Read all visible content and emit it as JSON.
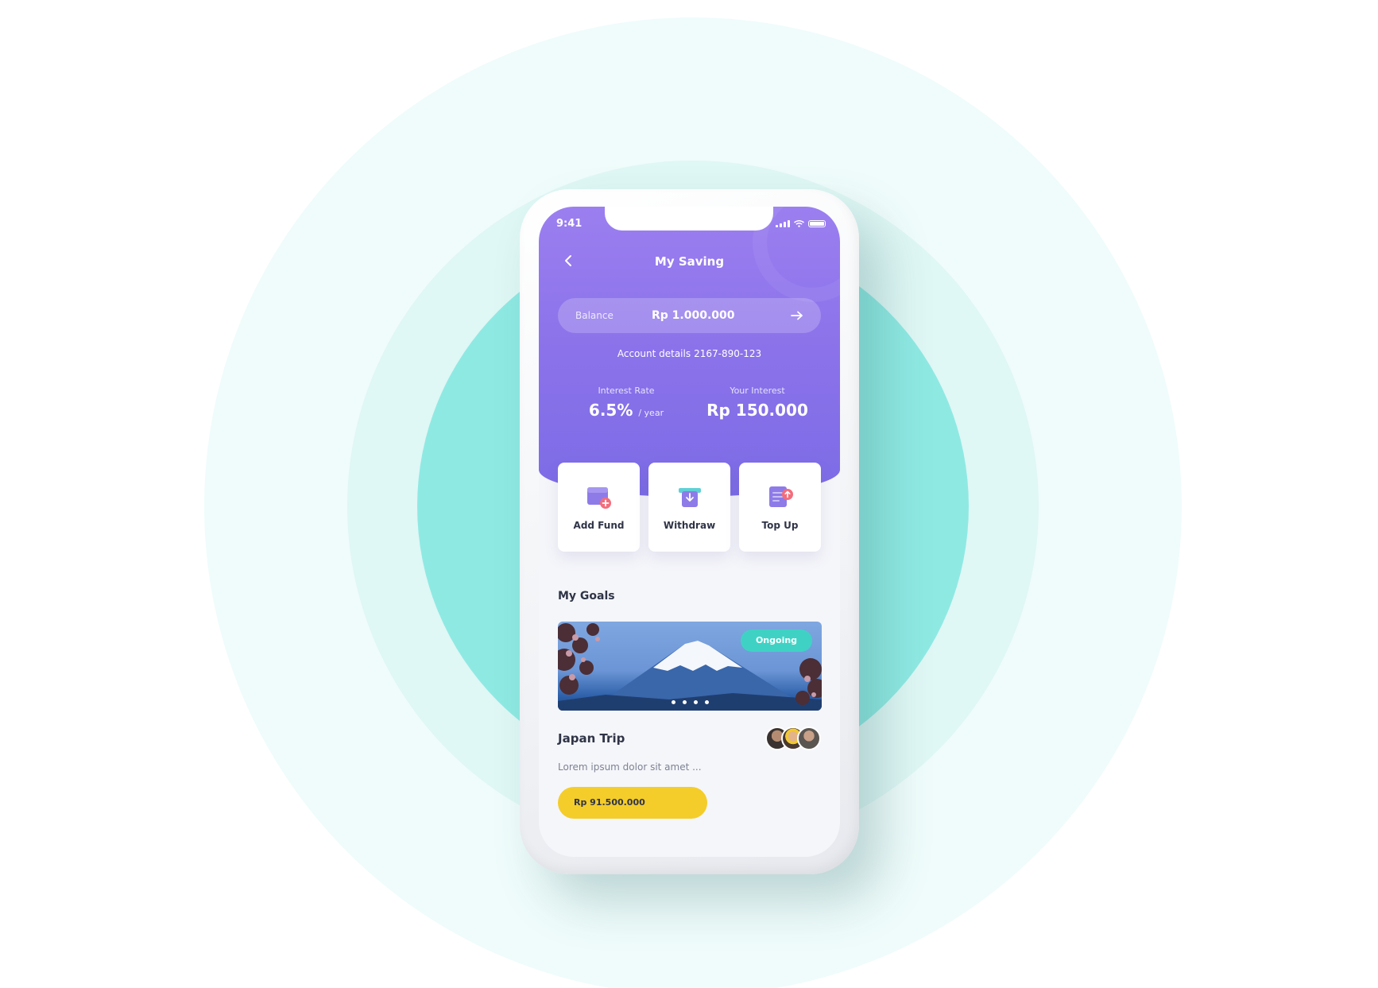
{
  "status_bar": {
    "time": "9:41"
  },
  "header": {
    "title": "My Saving",
    "balance": {
      "label": "Balance",
      "value": "Rp 1.000.000"
    },
    "account": {
      "label": "Account details",
      "number": "2167-890-123"
    },
    "interest_rate": {
      "label": "Interest Rate",
      "value": "6.5%",
      "unit": "/ year"
    },
    "your_interest": {
      "label": "Your Interest",
      "value": "Rp 150.000"
    }
  },
  "actions": [
    {
      "label": "Add Fund",
      "icon": "wallet-add-icon"
    },
    {
      "label": "Withdraw",
      "icon": "withdraw-icon"
    },
    {
      "label": "Top Up",
      "icon": "top-up-icon"
    }
  ],
  "goals": {
    "section_title": "My Goals",
    "items": [
      {
        "name": "Japan Trip",
        "badge": "Ongoing",
        "description": "Lorem ipsum dolor sit amet ...",
        "amount": "Rp 91.500.000"
      }
    ]
  },
  "colors": {
    "header_purple": "#8b72ea",
    "badge_teal": "#3fd2c4",
    "amount_yellow": "#f4cd2a",
    "ring_teal": "#8fe9e3"
  }
}
